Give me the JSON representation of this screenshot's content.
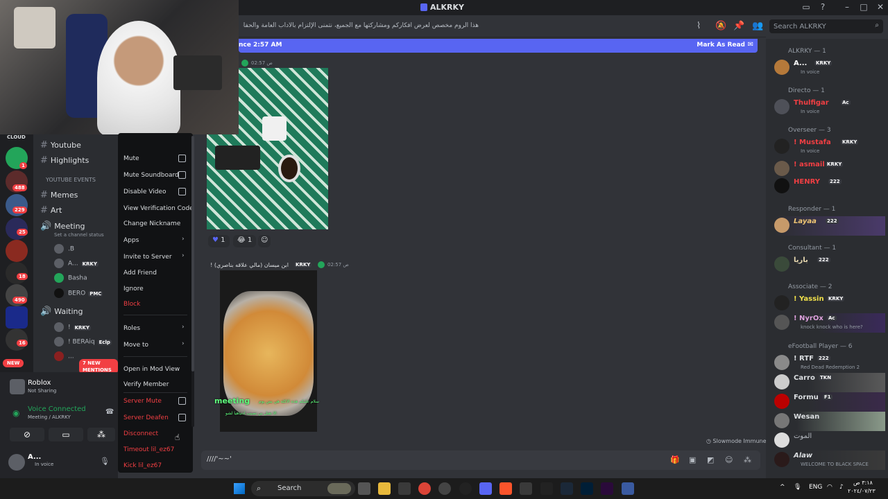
{
  "window": {
    "title": "ALKRKY"
  },
  "header": {
    "topic": "هذا الروم مخصص لعرض أفكاركم ومشاركتها مع الجميع، نتمنى الإلتزام بالآداب العامة والحفاظ على جودة المحتو.",
    "search_placeholder": "Search ALKRKY"
  },
  "new_messages": {
    "since": "nce 2:57 AM",
    "mark_read": "Mark As Read"
  },
  "channels": {
    "items": [
      {
        "label": "Youtube"
      },
      {
        "label": "Highlights"
      },
      {
        "label": "YOUTUBE EVENTS"
      },
      {
        "label": "Memes"
      },
      {
        "label": "Art"
      },
      {
        "label": "Meeting"
      },
      {
        "label": "Set a channel status"
      },
      {
        "label": "Waiting"
      }
    ],
    "voice_users": [
      ".B",
      "A...",
      "Basha",
      "BERO",
      "!",
      "! BERAiq",
      "..."
    ],
    "voice_tags": [
      "KRKY",
      "PMC",
      "KRKY",
      "Eclp"
    ],
    "new_mentions": "7 NEW MENTIONS",
    "new_badge": "NEW"
  },
  "rail": {
    "badges": [
      "1",
      "488",
      "229",
      "25",
      "18",
      "490",
      "16"
    ],
    "top_label": "CLOUD"
  },
  "activity": {
    "game": "Roblox",
    "status": "Not Sharing"
  },
  "voice": {
    "status": "Voice Connected",
    "location": "Meeting / ALKRKY"
  },
  "user": {
    "name": "A...",
    "status": "In voice"
  },
  "context_menu": {
    "mute": "Mute",
    "mute_soundboard": "Mute Soundboard",
    "disable_video": "Disable Video",
    "view_verification": "View Verification Code",
    "change_nickname": "Change Nickname",
    "apps": "Apps",
    "invite": "Invite to Server",
    "add_friend": "Add Friend",
    "ignore": "Ignore",
    "block": "Block",
    "roles": "Roles",
    "move_to": "Move to",
    "mod_view": "Open in Mod View",
    "verify": "Verify Member",
    "server_mute": "Server Mute",
    "server_deafen": "Server Deafen",
    "disconnect": "Disconnect",
    "timeout": "Timeout lil_ez67",
    "kick": "Kick lil_ez67"
  },
  "messages": {
    "m1_time": "02:57 ص",
    "m1_reactions": [
      "1",
      "1"
    ],
    "m2_author": "ابن ميسان (مالي علاقه بناصري) !",
    "m2_tag": "KRKY",
    "m2_time": "02:57 ص",
    "m2_overlay": "meeting",
    "m2_overlay_line1": "سلام عليكم هذه الاكلة هي بس يوم",
    "m2_overlay_line2": "الا تقتل بي نصيب ادتباهيا لشو"
  },
  "slowmode": "Slowmode Immune",
  "composer": {
    "value": "////'~~'"
  },
  "members": {
    "groups": [
      {
        "title": "ALKRKY — 1"
      },
      {
        "title": "Directo — 1"
      },
      {
        "title": "Overseer — 3"
      },
      {
        "title": "Responder — 1"
      },
      {
        "title": "Consultant — 1"
      },
      {
        "title": "Associate — 2"
      },
      {
        "title": "eFootball Player — 6"
      }
    ],
    "list": [
      {
        "name": "A...",
        "tag": "KRKY",
        "status": "In voice",
        "color": "#ffffff"
      },
      {
        "name": "Thulfigar",
        "tag": "Ac",
        "status": "In voice",
        "color": "#f23f43"
      },
      {
        "name": "! Mustafa",
        "tag": "KRKY",
        "status": "In voice",
        "color": "#f23f43"
      },
      {
        "name": "! asmail",
        "tag": "KRKY",
        "status": "",
        "color": "#f23f43"
      },
      {
        "name": "HENRY",
        "tag": "222",
        "status": "",
        "color": "#f23f43"
      },
      {
        "name": "Layaa",
        "tag": "222",
        "status": "",
        "color": "#f0c674"
      },
      {
        "name": "باريا",
        "tag": "222",
        "status": "",
        "color": "#e8d9b0"
      },
      {
        "name": "! Yassin",
        "tag": "KRKY",
        "status": "",
        "color": "#f0e04a"
      },
      {
        "name": "! NyrOx",
        "tag": "Ac",
        "status": "knock knock who is here?",
        "color": "#dda0dd"
      },
      {
        "name": "! RTF",
        "tag": "222",
        "status": "Red Dead Redemption 2",
        "color": "#dbdee1"
      },
      {
        "name": "Carro",
        "tag": "TKN",
        "status": "",
        "color": "#dbdee1"
      },
      {
        "name": "Formu",
        "tag": "F1",
        "status": "",
        "color": "#dbdee1"
      },
      {
        "name": "Wesan",
        "tag": "",
        "status": "",
        "color": "#dbdee1"
      },
      {
        "name": "الموت",
        "tag": "",
        "status": "",
        "color": "#b5bac1"
      },
      {
        "name": "Alaw",
        "tag": "",
        "status": "WELCOME TO BLACK SPACE",
        "color": "#dbdee1"
      }
    ]
  },
  "taskbar": {
    "search": "Search",
    "lang": "ENG",
    "time": "٣:١٨ ص",
    "date": "٢٠٢٤/٠٧/٢٣"
  },
  "colors": {
    "blurple": "#5865f2",
    "danger": "#f23f43",
    "online": "#23a55a"
  }
}
